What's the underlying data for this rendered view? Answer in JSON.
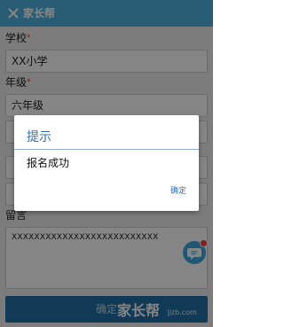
{
  "header": {
    "title": "家长帮"
  },
  "form": {
    "school_label": "学校",
    "school_value": "XX小学",
    "grade_label": "年级",
    "grade_value": "六年级",
    "message_label": "留言",
    "message_value": "XXXXXXXXXXXXXXXXXXXXXXXXXX",
    "required_mark": "*",
    "confirm_label": "确定"
  },
  "dialog": {
    "title": "提示",
    "message": "报名成功",
    "ok_label": "确定"
  },
  "watermark": {
    "brand": "家长帮",
    "site": "|jzb.com"
  },
  "colors": {
    "header": "#4fb3e3",
    "accent": "#2b6fb7",
    "badge": "#ff3b30"
  }
}
